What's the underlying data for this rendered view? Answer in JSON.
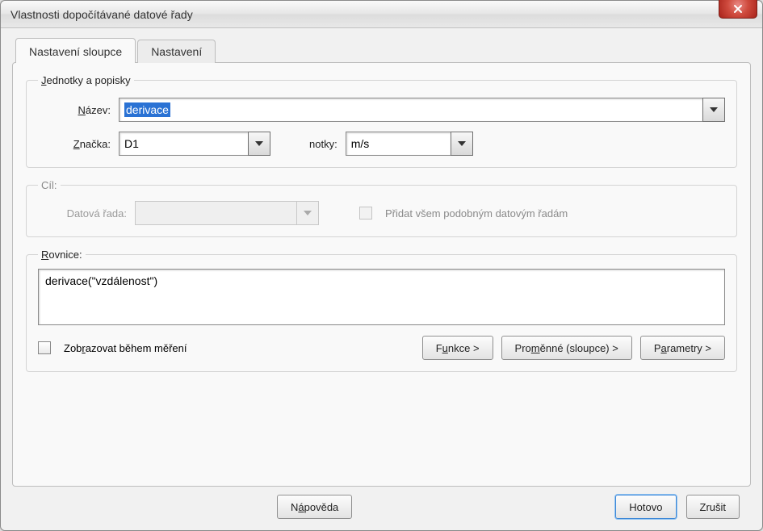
{
  "window": {
    "title": "Vlastnosti dopočítávané datové řady"
  },
  "tabs": {
    "col_settings": "Nastavení sloupce",
    "settings": "Nastavení"
  },
  "group_labels": {
    "units": "Jednotky a popisky",
    "target": "Cíl:",
    "equation": "Rovnice:"
  },
  "fields": {
    "name_label_pre": "N",
    "name_label_post": "ázev:",
    "name_value": "derivace",
    "symbol_label_pre": "Z",
    "symbol_label_post": "načka:",
    "symbol_value": "D1",
    "units_label": "notky:",
    "units_value": "m/s",
    "dataseries_label": "Datová řada:",
    "add_similar_label": "Přidat všem podobným datovým řadám",
    "equation_value": "derivace(\"vzdálenost\")",
    "show_during_pre": "Zob",
    "show_during_u": "r",
    "show_during_post": "azovat během měření"
  },
  "buttons": {
    "functions_pre": "F",
    "functions_u": "u",
    "functions_post": "nkce >",
    "vars_pre": "Pro",
    "vars_u": "m",
    "vars_post": "ěnné (sloupce) >",
    "params_pre": "P",
    "params_u": "a",
    "params_post": "rametry >",
    "help_pre": "N",
    "help_u": "á",
    "help_post": "pověda",
    "done": "Hotovo",
    "cancel": "Zrušit"
  }
}
